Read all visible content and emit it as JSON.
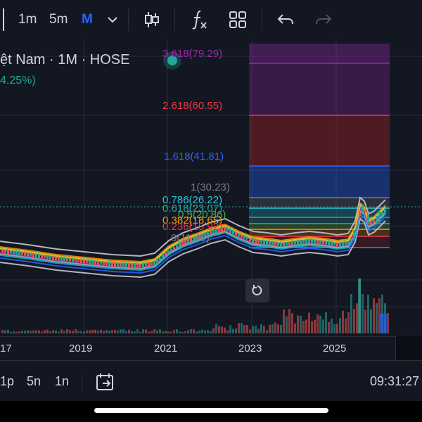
{
  "toolbar": {
    "interval_1m": "1m",
    "interval_5m": "5m",
    "interval_M": "M"
  },
  "symbol": {
    "title": "ệt Nam · 1M · HOSE",
    "change": "4.25%)"
  },
  "fib_levels": [
    {
      "label": "3.618(79.29)",
      "color": "#9c27b0"
    },
    {
      "label": "2.618(60.55)",
      "color": "#f23645"
    },
    {
      "label": "1.618(41.81)",
      "color": "#2962ff"
    },
    {
      "label": "1(30.23)",
      "color": "#787b86"
    },
    {
      "label": "0.786(26.22)",
      "color": "#26c6da"
    },
    {
      "label": "0.618(23.07)",
      "color": "#26a69a"
    },
    {
      "label": "0.5(20.86)",
      "color": "#4caf50"
    },
    {
      "label": "0.382(18.65)",
      "color": "#ff9800"
    },
    {
      "label": "0.236(15.92)",
      "color": "#f23645"
    },
    {
      "label": "0(11.49)",
      "color": "#787b86"
    }
  ],
  "time_axis": {
    "labels": [
      "17",
      "2019",
      "2021",
      "2023",
      "2025"
    ]
  },
  "bottom_bar": {
    "range_1p": "1p",
    "range_5n": "5n",
    "range_1n": "1n",
    "clock": "09:31:27"
  },
  "colors": {
    "background": "#131722",
    "accent": "#2962ff",
    "up": "#26a69a",
    "down": "#ef5350"
  },
  "icons": [
    "candles-icon",
    "indicators-icon",
    "layout-grid-icon",
    "undo-icon",
    "redo-icon",
    "chevron-down-icon",
    "reset-chart-icon",
    "go-to-date-icon"
  ]
}
